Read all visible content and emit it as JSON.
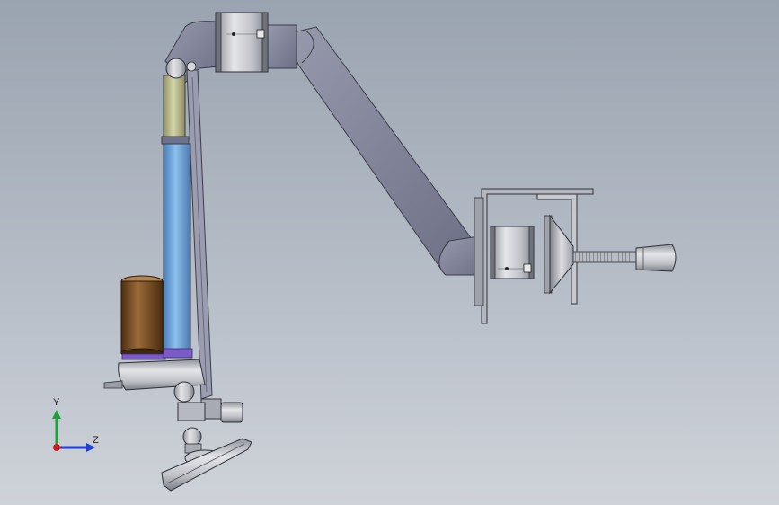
{
  "viewport": {
    "background_top": "#9aa3b0",
    "background_bottom": "#cfd3d9"
  },
  "model": {
    "description_tag": "robotic-arm-assembly",
    "colors": {
      "arm_gray": "#7d7f95",
      "joint_metal": "#c9cbd0",
      "blue_cylinder": "#6aa4dc",
      "olive_cylinder": "#b8b98a",
      "brown_motor": "#7a4e24",
      "purple_ring": "#7b5cc7",
      "bracket": "#b3b6bf"
    }
  },
  "triad": {
    "y_label": "Y",
    "z_label": "Z",
    "y_color": "#1aa33a",
    "z_color": "#1f3fd0",
    "origin_color": "#d01c1c"
  }
}
